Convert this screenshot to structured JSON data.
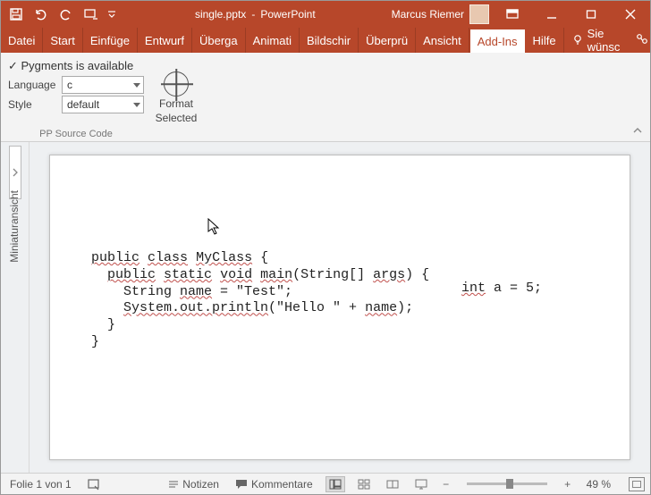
{
  "titlebar": {
    "filename": "single.pptx",
    "sep": " - ",
    "app": "PowerPoint",
    "user": "Marcus Riemer"
  },
  "tabs": {
    "datei": "Datei",
    "start": "Start",
    "einfuegen": "Einfüge",
    "entwurf": "Entwurf",
    "uebergange": "Überga",
    "animationen": "Animati",
    "bildschirm": "Bildschir",
    "ueberpruefen": "Überprü",
    "ansicht": "Ansicht",
    "addins": "Add-Ins",
    "hilfe": "Hilfe",
    "tell_me": "Sie wünsc",
    "teilen": "Teilen"
  },
  "ribbon": {
    "pygments_check": "Pygments is available",
    "language_label": "Language",
    "language_value": "c",
    "style_label": "Style",
    "style_value": "default",
    "group_name": "PP Source Code",
    "format_line1": "Format",
    "format_line2": "Selected"
  },
  "thumb_label": "Miniaturansicht",
  "slide": {
    "code": "public class MyClass {\n  public static void main(String[] args) {\n    String name = \"Test\";\n    System.out.println(\"Hello \" + name);\n  }\n}",
    "code_side": "int a = 5;"
  },
  "status": {
    "slide_counter": "Folie 1 von 1",
    "notizen": "Notizen",
    "kommentare": "Kommentare",
    "zoom": "49 %"
  }
}
